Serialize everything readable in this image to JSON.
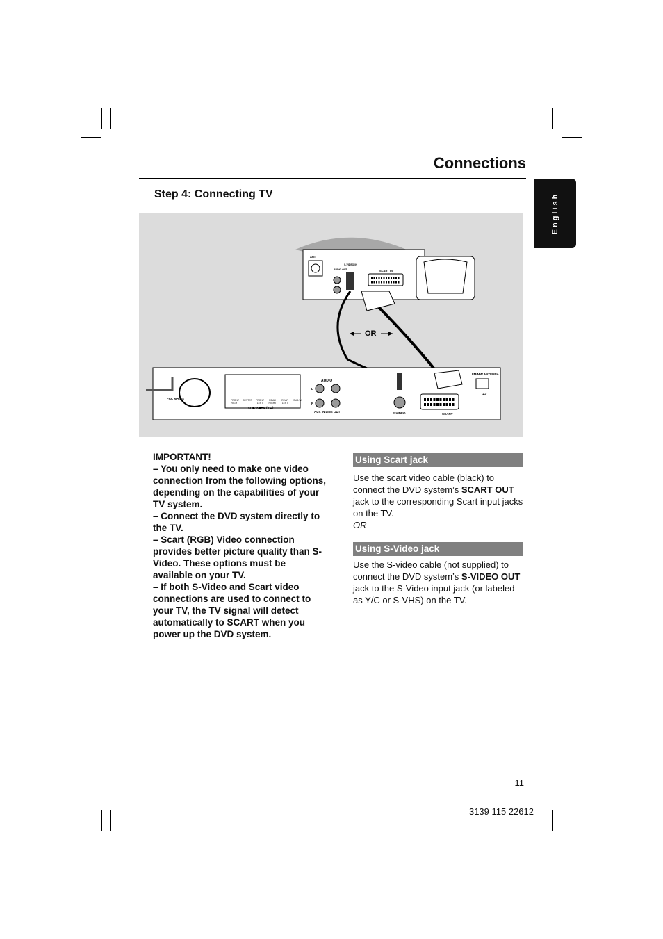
{
  "header": {
    "title": "Connections",
    "language_tab": "English"
  },
  "step_heading": "Step 4:  Connecting TV",
  "figure": {
    "tv_labels": {
      "ant": "ANT",
      "audio_out": "AUDIO OUT",
      "s_video_in": "S-VIDEO IN",
      "scart_in": "SCART IN",
      "l": "L",
      "r": "R"
    },
    "or_label": "OR",
    "dvd_labels": {
      "ac_mains": "~AC MAINS",
      "speakers": "SPEAKERS (4 Ω)",
      "speaker_jacks": [
        "FRONT RIGHT",
        "CENTER",
        "FRONT LEFT",
        "REAR RIGHT",
        "REAR LEFT",
        "SUB-W"
      ],
      "audio": "AUDIO",
      "aux_line": "AUX IN  LINE OUT",
      "s_video": "S-VIDEO",
      "scart": "SCART",
      "antenna": "FM/MW ANTENNA",
      "mw": "MW",
      "fm": "FM",
      "l": "L",
      "r": "R"
    }
  },
  "important": {
    "title": "IMPORTANT!",
    "item1_pre": "–     You only need to make ",
    "item1_u": "one",
    "item1_post": " video connection from the following options, depending on the capabilities of your TV system.",
    "item2": "–     Connect the DVD system directly to the TV.",
    "item3": "–     Scart (RGB) Video connection provides better picture quality than S-Video. These options must be available on your TV.",
    "item4": "–      If both S-Video and Scart video connections are used to connect to your TV, the TV signal will detect automatically to SCART when you power up the DVD system."
  },
  "scart_section": {
    "heading": "Using Scart jack",
    "t1": "Use the scart video cable (black) to connect the DVD system’s ",
    "b1": "SCART OUT",
    "t2": " jack to the corresponding Scart input jacks on the TV.",
    "or": "OR"
  },
  "svideo_section": {
    "heading": "Using S-Video jack",
    "t1": "Use the S-video cable (not supplied) to connect the DVD system’s ",
    "b1": "S-VIDEO OUT",
    "t2": " jack to the S-Video input jack (or labeled as Y/C or S-VHS) on the TV."
  },
  "footer": {
    "page_number": "11",
    "code": "3139 115 22612"
  }
}
